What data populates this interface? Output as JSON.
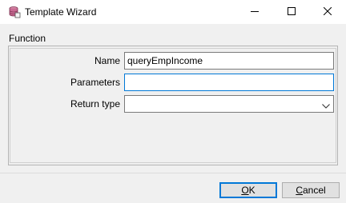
{
  "window": {
    "title": "Template Wizard",
    "icon": "database-template-icon"
  },
  "group": {
    "label": "Function"
  },
  "fields": {
    "name": {
      "label": "Name",
      "value": "queryEmpIncome"
    },
    "parameters": {
      "label": "Parameters",
      "value": ""
    },
    "return_type": {
      "label": "Return type",
      "value": ""
    }
  },
  "buttons": {
    "ok": {
      "mnemonic": "O",
      "rest": "K"
    },
    "cancel": {
      "mnemonic": "C",
      "rest": "ancel"
    }
  },
  "colors": {
    "focus_border": "#0078d7",
    "window_bg": "#f0f0f0",
    "titlebar_bg": "#ffffff"
  }
}
